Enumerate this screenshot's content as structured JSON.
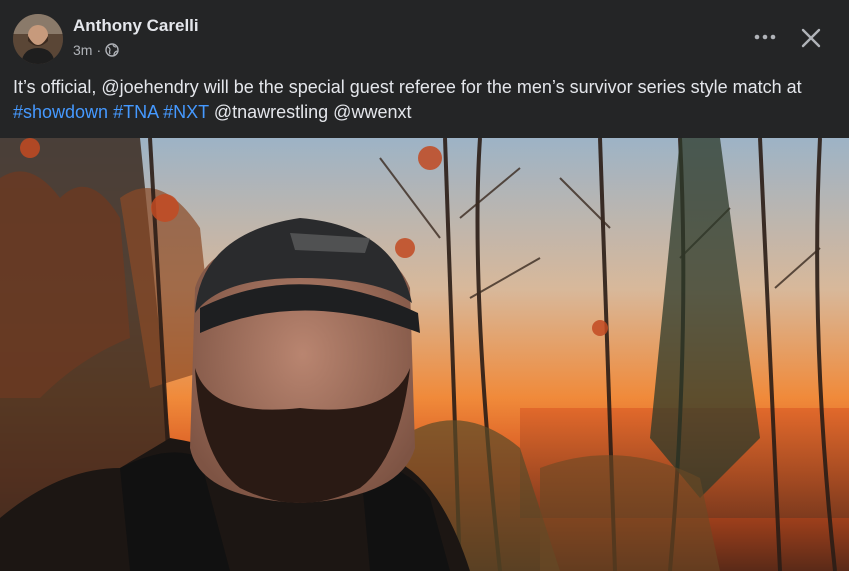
{
  "post": {
    "author_name": "Anthony Carelli",
    "timestamp": "3m",
    "separator": "·",
    "privacy_icon": "globe-icon",
    "more_icon": "more-horizontal-icon",
    "close_icon": "close-icon",
    "text_intro": "It’s official, ",
    "mention_1": "@joehendry",
    "text_middle": " will be the special guest referee for the men’s survivor series style match at ",
    "hashtag_1": "#showdown",
    "hashtag_2": "#TNA",
    "hashtag_3": "#NXT",
    "mention_2": "@tnawrestling",
    "mention_3": "@wwenxt"
  },
  "colors": {
    "background": "#242526",
    "text": "#e4e6eb",
    "secondary_text": "#b0b3b8",
    "hashtag": "#4599ff"
  }
}
